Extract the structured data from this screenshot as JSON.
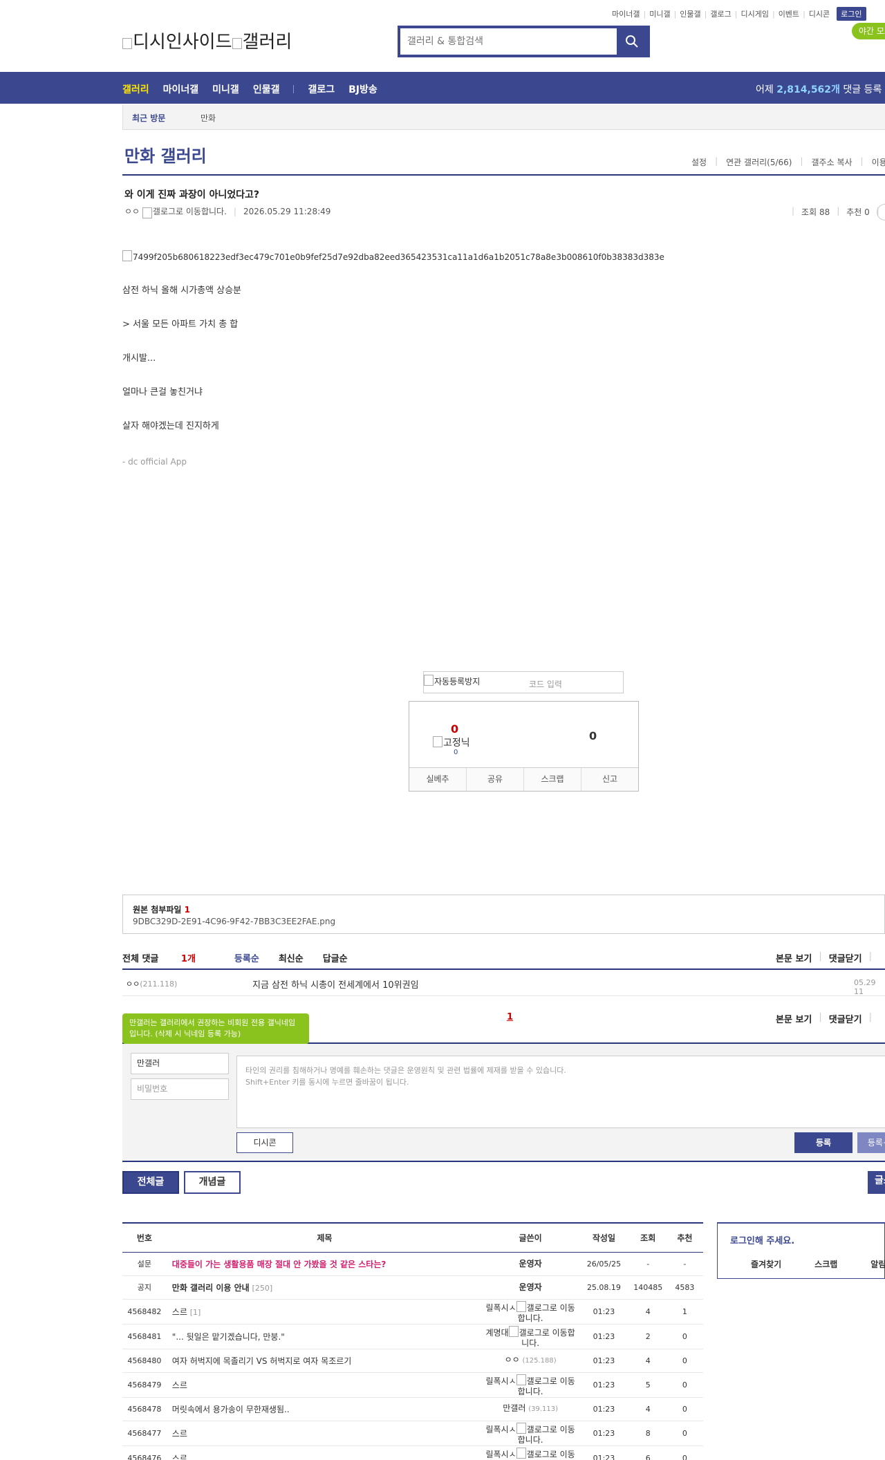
{
  "util_menu": [
    "마이너갤",
    "미니갤",
    "인물갤",
    "갤로그",
    "디시게임",
    "이벤트",
    "디시콘"
  ],
  "login_label": "로그인",
  "night_mode_label": "야간 모드",
  "logo_alt_1": "디시인사이드",
  "logo_alt_2": "갤러리",
  "search_placeholder": "갤러리 & 통합검색",
  "nav": [
    "갤러리",
    "마이너갤",
    "미니갤",
    "인물갤",
    "갤로그",
    "BJ방송"
  ],
  "stats": {
    "prefix": "어제",
    "count": "2,814,562개",
    "suffix": "댓글 등록"
  },
  "recent": {
    "label": "최근 방문",
    "item": "만화"
  },
  "gallery_title": "만화 갤러리",
  "gallery_links": [
    "설정",
    "연관 갤러리(5/66)",
    "갤주소 복사",
    "이용"
  ],
  "post": {
    "title": "와 이게 진짜 과장이 아니었다고?",
    "author": "ㅇㅇ",
    "gallog_alt": "갤로그로 이동합니다.",
    "date": "2026.05.29 11:28:49",
    "views": "조회 88",
    "recommend": "추천 0",
    "image_alt": "7499f205b680618223edf3ec479c701e0b9fef25d7e92dba82eed365423531ca11a1d6a1b2051c78a8e3b008610f0b38383d383e",
    "lines": [
      "삼전 하닉 올해 시가총액 상승분",
      "> 서울 모든 아파트 가치 총 합",
      "개시발...",
      "얼마나 큰걸 놓친거냐",
      "살자 해야겠는데 진지하게"
    ],
    "app_note": "- dc official App"
  },
  "captcha": {
    "alt": "자동등록방지",
    "placeholder": "코드 입력"
  },
  "recommend_box": {
    "up": "0",
    "fix_alt": "고정닉",
    "fix_count": "0",
    "down": "0",
    "actions": [
      "실베추",
      "공유",
      "스크랩",
      "신고"
    ]
  },
  "attachment": {
    "label": "원본 첨부파일",
    "count": "1",
    "file": "9DBC329D-2E91-4C96-9F42-7BB3C3EE2FAE.png"
  },
  "comments": {
    "all_label": "전체 댓글",
    "count": "1개",
    "sorts": [
      "등록순",
      "최신순",
      "답글순"
    ],
    "view_post": "본문 보기",
    "close": "댓글닫기",
    "item": {
      "writer": "ㅇㅇ",
      "ip": "(211.118)",
      "text": "지금 삼전 하닉 시총이 전세계에서 10위권임",
      "date": "05.29 11"
    },
    "page": "1"
  },
  "tooltip": "만갤러는 갤러리에서 권장하는 비회원 전용 갤닉네임입니다. (삭제 시 닉네임 등록 가능)",
  "write": {
    "nickname": "만갤러",
    "password_placeholder": "비밀번호",
    "textarea_line1": "타인의 권리를 침해하거나 명예를 훼손하는 댓글은 운영원칙 및 관련 법률에 제재를 받을 수 있습니다.",
    "textarea_line2": "Shift+Enter 키를 동시에 누르면 줄바꿈이 됩니다.",
    "dccon": "디시콘",
    "submit": "등록",
    "submit2": "등록+추천"
  },
  "tabs": {
    "all": "전체글",
    "concept": "개념글",
    "write": "글쓰기"
  },
  "list": {
    "headers": [
      "번호",
      "제목",
      "글쓴이",
      "작성일",
      "조회",
      "추천"
    ],
    "rows": [
      {
        "no": "설문",
        "title": "대중들이 가는 생활용품 매장 절대 안 가봤을 것 같은 스타는?",
        "rc": "",
        "writer": "운영자",
        "ip": "",
        "date": "26/05/25",
        "views": "-",
        "rec": "-",
        "kind": "survey"
      },
      {
        "no": "공지",
        "title": "만화 갤러리 이용 안내",
        "rc": "[250]",
        "writer": "운영자",
        "ip": "",
        "date": "25.08.19",
        "views": "140485",
        "rec": "4583",
        "kind": "notice"
      },
      {
        "no": "4568482",
        "title": "스르",
        "rc": "[1]",
        "writer": "릴폭시ㅅ",
        "ip": "gallog",
        "date": "01:23",
        "views": "4",
        "rec": "1",
        "kind": "normal"
      },
      {
        "no": "4568481",
        "title": "\"... 뒷일은 맡기겠습니다, 만붕.\"",
        "rc": "",
        "writer": "계명대",
        "ip": "gallog",
        "date": "01:23",
        "views": "2",
        "rec": "0",
        "kind": "normal"
      },
      {
        "no": "4568480",
        "title": "여자 허벅지에 목졸리기 VS 허벅지로 여자 목조르기",
        "rc": "",
        "writer": "ㅇㅇ",
        "ip": "(125.188)",
        "date": "01:23",
        "views": "4",
        "rec": "0",
        "kind": "normal"
      },
      {
        "no": "4568479",
        "title": "스르",
        "rc": "",
        "writer": "릴폭시ㅅ",
        "ip": "gallog",
        "date": "01:23",
        "views": "5",
        "rec": "0",
        "kind": "normal"
      },
      {
        "no": "4568478",
        "title": "머릿속에서 용가송이 무한재생됨..",
        "rc": "",
        "writer": "만갤러",
        "ip": "(39.113)",
        "date": "01:23",
        "views": "4",
        "rec": "0",
        "kind": "normal"
      },
      {
        "no": "4568477",
        "title": "스르",
        "rc": "",
        "writer": "릴폭시ㅅ",
        "ip": "gallog",
        "date": "01:23",
        "views": "8",
        "rec": "0",
        "kind": "normal"
      },
      {
        "no": "4568476",
        "title": "스르",
        "rc": "",
        "writer": "릴폭시ㅅ",
        "ip": "gallog",
        "date": "01:23",
        "views": "6",
        "rec": "0",
        "kind": "normal"
      }
    ]
  },
  "side": {
    "login_prompt": "로그인해 주세요.",
    "links": [
      "즐겨찾기",
      "스크랩",
      "알림"
    ]
  }
}
